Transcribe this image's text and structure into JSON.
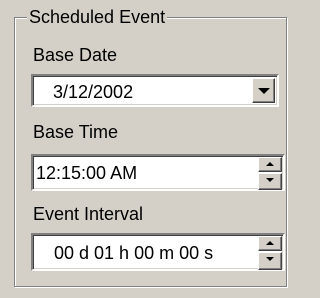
{
  "groupbox": {
    "title": "Scheduled Event"
  },
  "base_date": {
    "label": "Base Date",
    "value": "3/12/2002",
    "icon": "chevron-down-icon"
  },
  "base_time": {
    "label": "Base Time",
    "value": "12:15:00 AM",
    "icons": [
      "spin-up-icon",
      "spin-down-icon"
    ]
  },
  "event_interval": {
    "label": "Event Interval",
    "value": "00 d 01 h 00 m 00 s",
    "icons": [
      "spin-up-icon",
      "spin-down-icon"
    ]
  },
  "colors": {
    "face": "#d4d0c8",
    "field_bg": "#ffffff",
    "shadow": "#808080",
    "highlight": "#ffffff",
    "text": "#000000"
  }
}
